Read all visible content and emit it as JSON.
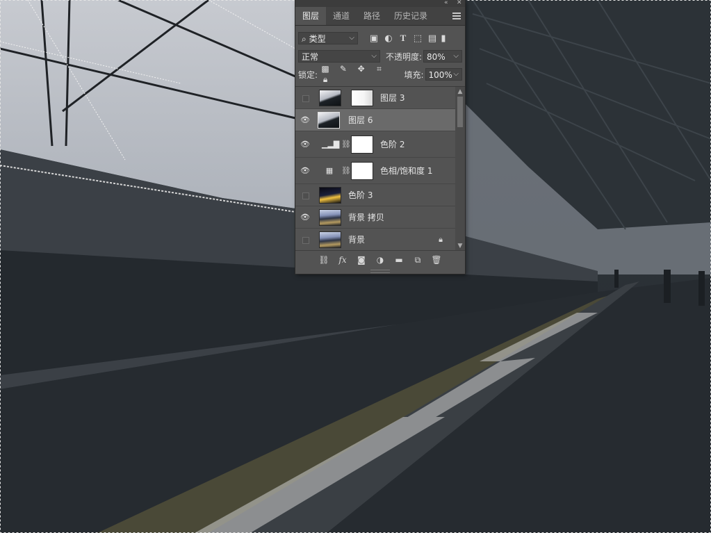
{
  "panel": {
    "tabs": [
      {
        "label": "图层",
        "active": true
      },
      {
        "label": "通道",
        "active": false
      },
      {
        "label": "路径",
        "active": false
      },
      {
        "label": "历史记录",
        "active": false
      }
    ],
    "filter": {
      "label": "类型"
    },
    "blend": {
      "value": "正常"
    },
    "opacity": {
      "label": "不透明度:",
      "value": "80%"
    },
    "lock": {
      "label": "锁定:"
    },
    "fill": {
      "label": "填充:",
      "value": "100%"
    },
    "layers": [
      {
        "name": "图层 3",
        "visible": false,
        "thumb": "sky",
        "mask": true,
        "selected": false
      },
      {
        "name": "图层 6",
        "visible": true,
        "thumb": "sky",
        "mask": false,
        "selected": true
      },
      {
        "name": "色阶 2",
        "visible": true,
        "adjustment": "levels",
        "selected": false
      },
      {
        "name": "色相/饱和度 1",
        "visible": true,
        "adjustment": "huesat",
        "selected": false
      },
      {
        "name": "色阶 3",
        "visible": false,
        "thumb": "dark",
        "mask": false,
        "selected": false
      },
      {
        "name": "背景 拷贝",
        "visible": true,
        "thumb": "photo",
        "mask": false,
        "selected": false
      },
      {
        "name": "背景",
        "visible": false,
        "thumb": "photo",
        "mask": false,
        "locked": true,
        "selected": false
      }
    ]
  }
}
